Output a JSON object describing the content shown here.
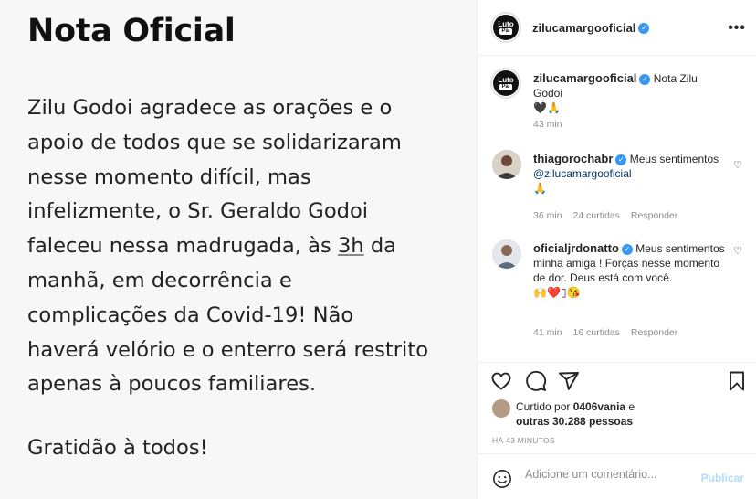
{
  "note": {
    "title": "Nota Oficial",
    "lines": [
      "Zilu Godoi agradece as orações e o",
      "apoio de todos que se solidarizaram",
      "nesse momento difícil, mas",
      "infelizmente, o Sr. Geraldo Godoi",
      "faleceu nessa madrugada, às ",
      "manhã, em decorrência e",
      "complicações da Covid-19! Não",
      "haverá velório e o enterro será restrito",
      "apenas à poucos familiares."
    ],
    "underlined_time": "3h",
    "line5_suffix": " da",
    "closing": "Gratidão à todos!"
  },
  "header": {
    "avatar_top": "Luto",
    "avatar_bottom": "Pai",
    "username": "zilucamargooficial",
    "more": "•••"
  },
  "caption": {
    "username": "zilucamargooficial",
    "text": "Nota Zilu Godoi",
    "emojis": "🖤🙏",
    "time": "43 min"
  },
  "comments": [
    {
      "username": "thiagorochabr",
      "text_before": "Meus sentimentos ",
      "mention": "@zilucamargooficial",
      "emojis": "🙏",
      "time": "36 min",
      "likes": "24 curtidas",
      "reply": "Responder"
    },
    {
      "username": "oficialjrdonatto",
      "text": "Meus sentimentos minha amiga ! Forças nesse momento de dor. Deus está com você.",
      "emojis": "🙌❤️▯😘",
      "time": "41 min",
      "likes": "16 curtidas",
      "reply": "Responder"
    }
  ],
  "likes": {
    "prefix": "Curtido por ",
    "user": "0406vania",
    "suffix": " e",
    "others": "outras 30.288 pessoas"
  },
  "timeago": "HÁ 43 MINUTOS",
  "comment_box": {
    "placeholder": "Adicione um comentário...",
    "publish": "Publicar"
  }
}
